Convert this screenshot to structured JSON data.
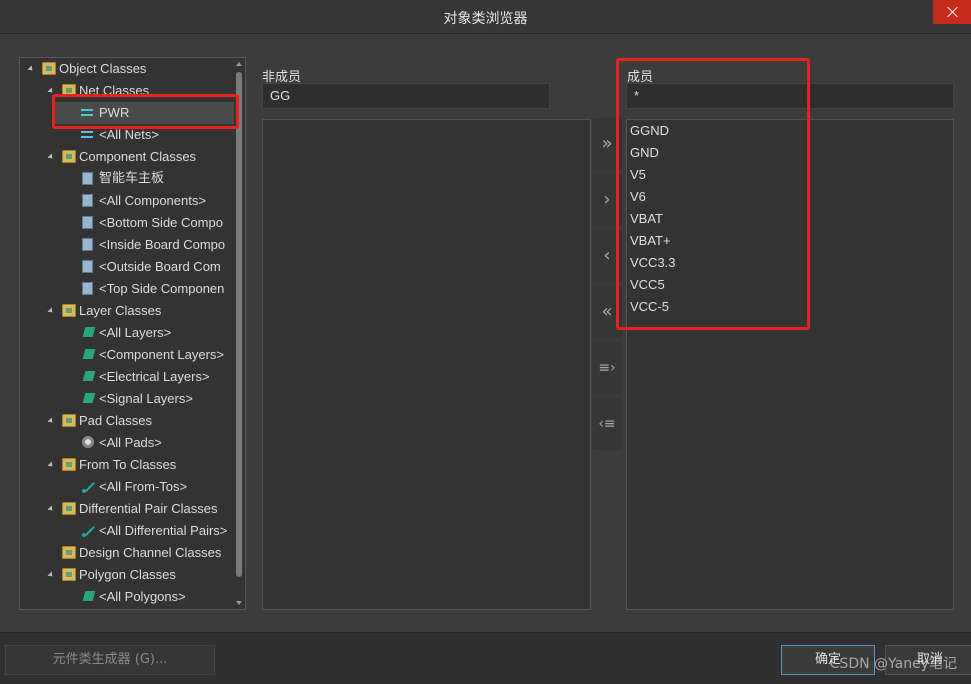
{
  "window": {
    "title": "对象类浏览器"
  },
  "tree": {
    "items": [
      {
        "label": "Object Classes",
        "icon": "folder-icon"
      },
      {
        "label": "Net Classes",
        "icon": "folder-icon"
      },
      {
        "label": "PWR",
        "icon": "net-icon",
        "selected": true
      },
      {
        "label": "<All Nets>",
        "icon": "net-icon"
      },
      {
        "label": "Component Classes",
        "icon": "folder-icon"
      },
      {
        "label": "智能车主板",
        "icon": "component-icon"
      },
      {
        "label": "<All Components>",
        "icon": "component-icon"
      },
      {
        "label": "<Bottom Side Compo",
        "icon": "component-icon"
      },
      {
        "label": "<Inside Board Compo",
        "icon": "component-icon"
      },
      {
        "label": "<Outside Board Com",
        "icon": "component-icon"
      },
      {
        "label": "<Top Side Componen",
        "icon": "component-icon"
      },
      {
        "label": "Layer Classes",
        "icon": "folder-icon"
      },
      {
        "label": "<All Layers>",
        "icon": "layer-icon"
      },
      {
        "label": "<Component Layers>",
        "icon": "layer-icon"
      },
      {
        "label": "<Electrical Layers>",
        "icon": "layer-icon"
      },
      {
        "label": "<Signal Layers>",
        "icon": "layer-icon"
      },
      {
        "label": "Pad Classes",
        "icon": "folder-icon"
      },
      {
        "label": "<All Pads>",
        "icon": "pad-icon"
      },
      {
        "label": "From To Classes",
        "icon": "folder-icon"
      },
      {
        "label": "<All From-Tos>",
        "icon": "from-to-icon"
      },
      {
        "label": "Differential Pair Classes",
        "icon": "folder-icon"
      },
      {
        "label": "<All Differential Pairs>",
        "icon": "from-to-icon"
      },
      {
        "label": "Design Channel Classes",
        "icon": "folder-icon"
      },
      {
        "label": "Polygon Classes",
        "icon": "folder-icon"
      },
      {
        "label": "<All Polygons>",
        "icon": "layer-icon"
      }
    ]
  },
  "non_members": {
    "label": "非成员",
    "filter_value": "GG",
    "items": []
  },
  "members": {
    "label": "成员",
    "filter_value": "*",
    "items": [
      "GGND",
      "GND",
      "V5",
      "V6",
      "VBAT",
      "VBAT+",
      "VCC3.3",
      "VCC5",
      "VCC-5"
    ]
  },
  "move_buttons": {
    "add_all": "»",
    "add": "›",
    "remove": "‹",
    "remove_all": "«",
    "add_filtered": "≡›",
    "remove_filtered": "‹≡"
  },
  "footer": {
    "generator_button": "元件类生成器 (G)...",
    "ok_button": "确定",
    "cancel_button": "取消",
    "watermark": "CSDN @Yaney笔记"
  },
  "colors": {
    "highlight": "#e8231f",
    "ok_border": "#5b8fd1",
    "close_bg": "#c42b1c"
  }
}
